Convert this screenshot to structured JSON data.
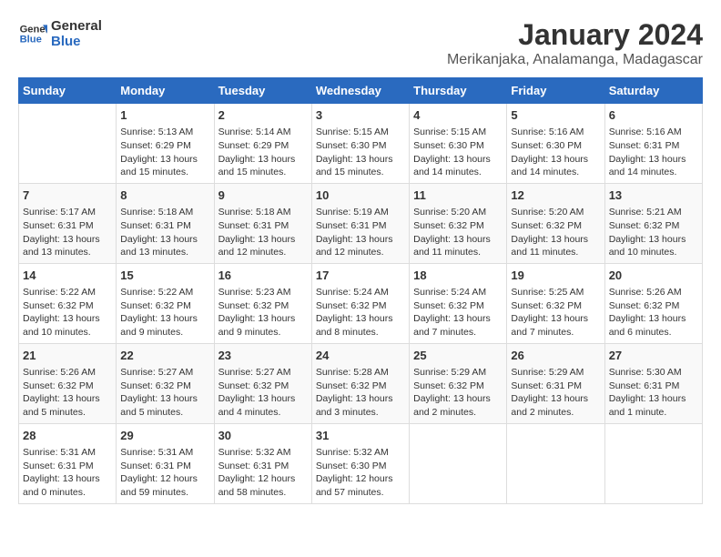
{
  "header": {
    "logo_line1": "General",
    "logo_line2": "Blue",
    "title": "January 2024",
    "subtitle": "Merikanjaka, Analamanga, Madagascar"
  },
  "weekdays": [
    "Sunday",
    "Monday",
    "Tuesday",
    "Wednesday",
    "Thursday",
    "Friday",
    "Saturday"
  ],
  "weeks": [
    [
      {
        "day": "",
        "info": ""
      },
      {
        "day": "1",
        "info": "Sunrise: 5:13 AM\nSunset: 6:29 PM\nDaylight: 13 hours\nand 15 minutes."
      },
      {
        "day": "2",
        "info": "Sunrise: 5:14 AM\nSunset: 6:29 PM\nDaylight: 13 hours\nand 15 minutes."
      },
      {
        "day": "3",
        "info": "Sunrise: 5:15 AM\nSunset: 6:30 PM\nDaylight: 13 hours\nand 15 minutes."
      },
      {
        "day": "4",
        "info": "Sunrise: 5:15 AM\nSunset: 6:30 PM\nDaylight: 13 hours\nand 14 minutes."
      },
      {
        "day": "5",
        "info": "Sunrise: 5:16 AM\nSunset: 6:30 PM\nDaylight: 13 hours\nand 14 minutes."
      },
      {
        "day": "6",
        "info": "Sunrise: 5:16 AM\nSunset: 6:31 PM\nDaylight: 13 hours\nand 14 minutes."
      }
    ],
    [
      {
        "day": "7",
        "info": "Sunrise: 5:17 AM\nSunset: 6:31 PM\nDaylight: 13 hours\nand 13 minutes."
      },
      {
        "day": "8",
        "info": "Sunrise: 5:18 AM\nSunset: 6:31 PM\nDaylight: 13 hours\nand 13 minutes."
      },
      {
        "day": "9",
        "info": "Sunrise: 5:18 AM\nSunset: 6:31 PM\nDaylight: 13 hours\nand 12 minutes."
      },
      {
        "day": "10",
        "info": "Sunrise: 5:19 AM\nSunset: 6:31 PM\nDaylight: 13 hours\nand 12 minutes."
      },
      {
        "day": "11",
        "info": "Sunrise: 5:20 AM\nSunset: 6:32 PM\nDaylight: 13 hours\nand 11 minutes."
      },
      {
        "day": "12",
        "info": "Sunrise: 5:20 AM\nSunset: 6:32 PM\nDaylight: 13 hours\nand 11 minutes."
      },
      {
        "day": "13",
        "info": "Sunrise: 5:21 AM\nSunset: 6:32 PM\nDaylight: 13 hours\nand 10 minutes."
      }
    ],
    [
      {
        "day": "14",
        "info": "Sunrise: 5:22 AM\nSunset: 6:32 PM\nDaylight: 13 hours\nand 10 minutes."
      },
      {
        "day": "15",
        "info": "Sunrise: 5:22 AM\nSunset: 6:32 PM\nDaylight: 13 hours\nand 9 minutes."
      },
      {
        "day": "16",
        "info": "Sunrise: 5:23 AM\nSunset: 6:32 PM\nDaylight: 13 hours\nand 9 minutes."
      },
      {
        "day": "17",
        "info": "Sunrise: 5:24 AM\nSunset: 6:32 PM\nDaylight: 13 hours\nand 8 minutes."
      },
      {
        "day": "18",
        "info": "Sunrise: 5:24 AM\nSunset: 6:32 PM\nDaylight: 13 hours\nand 7 minutes."
      },
      {
        "day": "19",
        "info": "Sunrise: 5:25 AM\nSunset: 6:32 PM\nDaylight: 13 hours\nand 7 minutes."
      },
      {
        "day": "20",
        "info": "Sunrise: 5:26 AM\nSunset: 6:32 PM\nDaylight: 13 hours\nand 6 minutes."
      }
    ],
    [
      {
        "day": "21",
        "info": "Sunrise: 5:26 AM\nSunset: 6:32 PM\nDaylight: 13 hours\nand 5 minutes."
      },
      {
        "day": "22",
        "info": "Sunrise: 5:27 AM\nSunset: 6:32 PM\nDaylight: 13 hours\nand 5 minutes."
      },
      {
        "day": "23",
        "info": "Sunrise: 5:27 AM\nSunset: 6:32 PM\nDaylight: 13 hours\nand 4 minutes."
      },
      {
        "day": "24",
        "info": "Sunrise: 5:28 AM\nSunset: 6:32 PM\nDaylight: 13 hours\nand 3 minutes."
      },
      {
        "day": "25",
        "info": "Sunrise: 5:29 AM\nSunset: 6:32 PM\nDaylight: 13 hours\nand 2 minutes."
      },
      {
        "day": "26",
        "info": "Sunrise: 5:29 AM\nSunset: 6:31 PM\nDaylight: 13 hours\nand 2 minutes."
      },
      {
        "day": "27",
        "info": "Sunrise: 5:30 AM\nSunset: 6:31 PM\nDaylight: 13 hours\nand 1 minute."
      }
    ],
    [
      {
        "day": "28",
        "info": "Sunrise: 5:31 AM\nSunset: 6:31 PM\nDaylight: 13 hours\nand 0 minutes."
      },
      {
        "day": "29",
        "info": "Sunrise: 5:31 AM\nSunset: 6:31 PM\nDaylight: 12 hours\nand 59 minutes."
      },
      {
        "day": "30",
        "info": "Sunrise: 5:32 AM\nSunset: 6:31 PM\nDaylight: 12 hours\nand 58 minutes."
      },
      {
        "day": "31",
        "info": "Sunrise: 5:32 AM\nSunset: 6:30 PM\nDaylight: 12 hours\nand 57 minutes."
      },
      {
        "day": "",
        "info": ""
      },
      {
        "day": "",
        "info": ""
      },
      {
        "day": "",
        "info": ""
      }
    ]
  ]
}
